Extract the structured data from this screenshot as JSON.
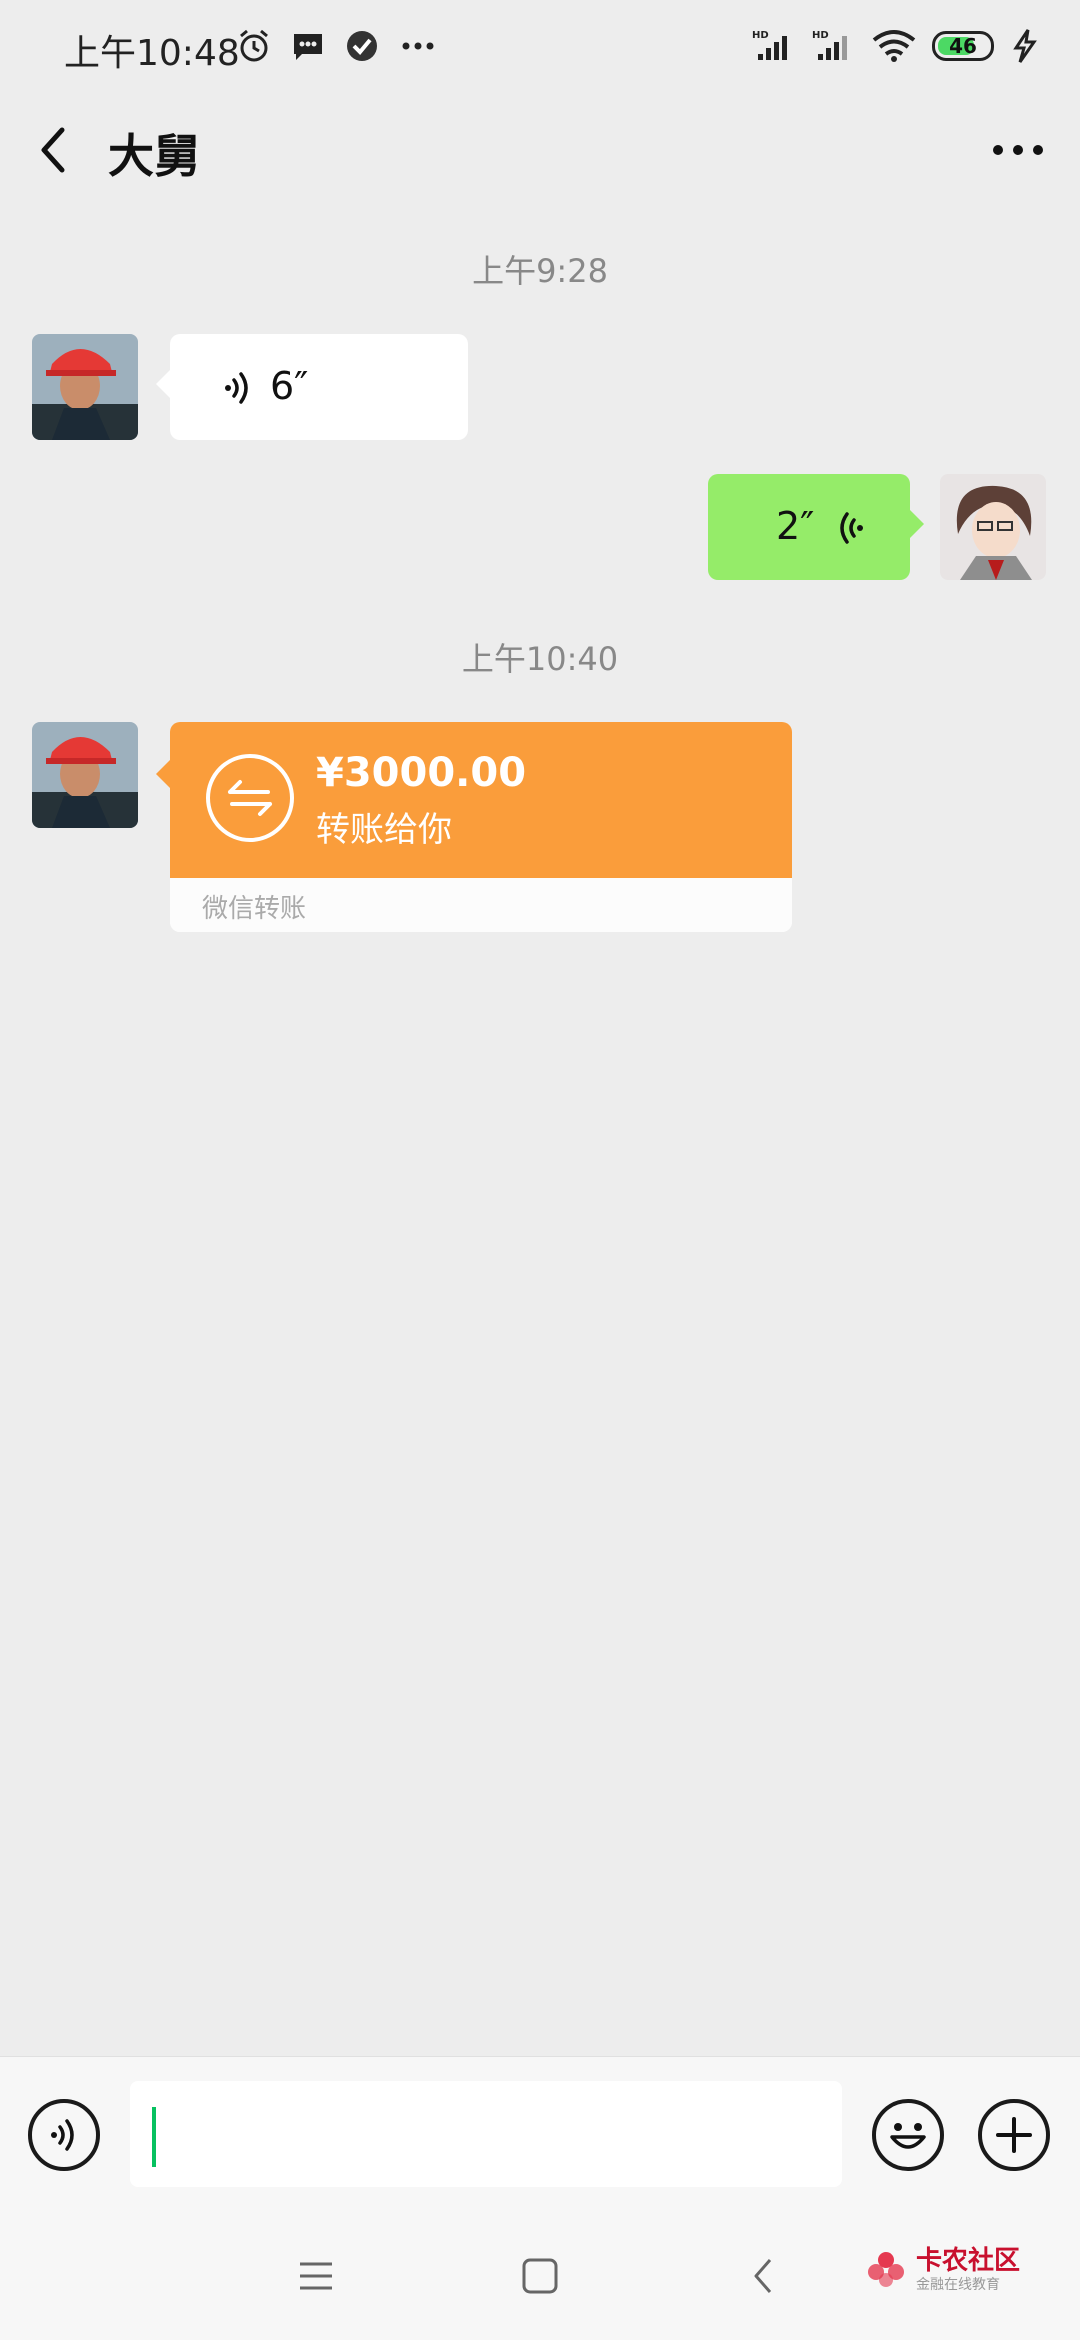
{
  "status_bar": {
    "time": "上午10:48",
    "battery": "46"
  },
  "header": {
    "title": "大舅"
  },
  "messages": [
    {
      "type": "time",
      "text": "上午9:28"
    },
    {
      "type": "voice",
      "side": "left",
      "duration": "6″"
    },
    {
      "type": "voice",
      "side": "right",
      "duration": "2″"
    },
    {
      "type": "time",
      "text": "上午10:40"
    },
    {
      "type": "transfer",
      "side": "left",
      "amount": "¥3000.00",
      "subtitle": "转账给你",
      "footer": "微信转账"
    }
  ],
  "colors": {
    "background": "#ededed",
    "sent_bubble": "#95ec69",
    "received_bubble": "#ffffff",
    "transfer": "#fa9d3b",
    "accent": "#07c160"
  },
  "icons": [
    "voice-wave-icon",
    "transfer-arrows-icon",
    "emoji-icon",
    "plus-icon",
    "back-icon",
    "more-icon"
  ],
  "input": {
    "value": ""
  },
  "watermark": {
    "title": "卡农社区",
    "subtitle": "金融在线教育"
  }
}
